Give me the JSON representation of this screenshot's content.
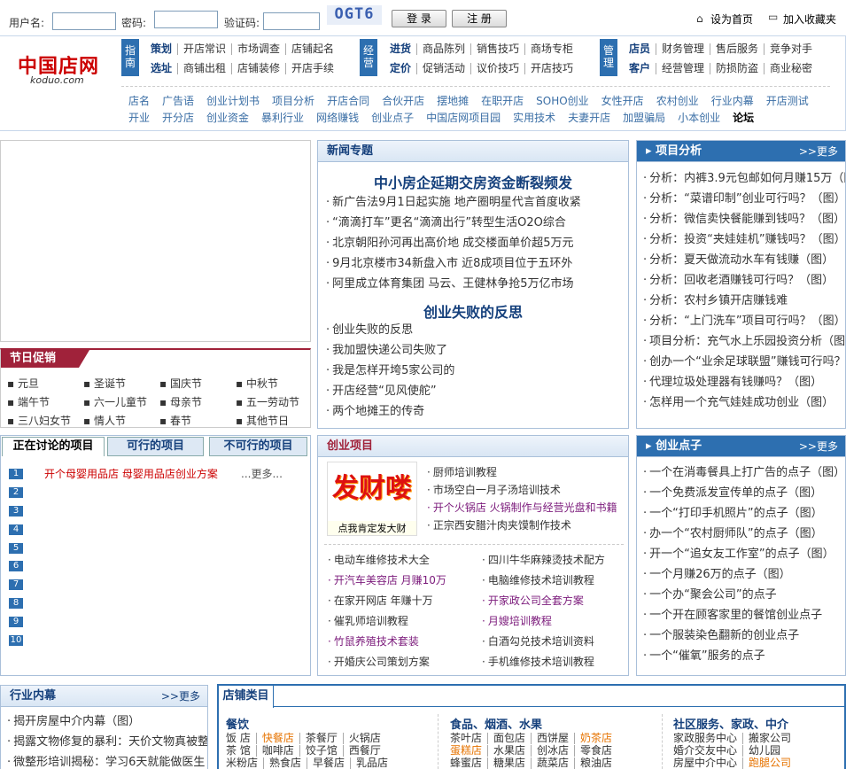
{
  "login": {
    "user_label": "用户名:",
    "pass_label": "密码:",
    "code_label": "验证码:",
    "captcha": "OGT6",
    "login_btn": "登 录",
    "register_btn": "注 册",
    "home": "设为首页",
    "fav": "加入收藏夹"
  },
  "logo": {
    "title": "中国店网",
    "site": "koduo.com"
  },
  "nav": {
    "g1": {
      "tag": "指南",
      "r1": [
        "策划",
        "开店常识",
        "市场调查",
        "店铺起名"
      ],
      "r2": [
        "选址",
        "商铺出租",
        "店铺装修",
        "开店手续"
      ]
    },
    "g2": {
      "tag": "经营",
      "r1": [
        "进货",
        "商品陈列",
        "销售技巧",
        "商场专柜"
      ],
      "r2": [
        "定价",
        "促销活动",
        "议价技巧",
        "开店技巧"
      ]
    },
    "g3": {
      "tag": "管理",
      "r1": [
        "店员",
        "财务管理",
        "售后服务",
        "竞争对手"
      ],
      "r2": [
        "客户",
        "经营管理",
        "防损防盗",
        "商业秘密"
      ]
    }
  },
  "links": {
    "r1": [
      "店名",
      "广告语",
      "创业计划书",
      "项目分析",
      "开店合同",
      "合伙开店",
      "摆地摊",
      "在职开店",
      "SOHO创业",
      "女性开店",
      "农村创业",
      "行业内幕",
      "开店测试"
    ],
    "r2": [
      "开业",
      "开分店",
      "创业资金",
      "暴利行业",
      "网络赚钱",
      "创业点子",
      "中国店网项目园",
      "实用技术",
      "夫妻开店",
      "加盟骗局",
      "小本创业",
      "论坛"
    ]
  },
  "holiday": {
    "title": "节日促销",
    "items": [
      "元旦",
      "圣诞节",
      "国庆节",
      "中秋节",
      "端午节",
      "六一儿童节",
      "母亲节",
      "五一劳动节",
      "三八妇女节",
      "情人节",
      "春节",
      "其他节日"
    ]
  },
  "news": {
    "title": "新闻专题",
    "h1": "中小房企延期交房资金断裂频发",
    "l1": [
      "新广告法9月1日起实施 地产圈明星代言首度收紧",
      "“滴滴打车”更名“滴滴出行”转型生活O2O综合",
      "北京朝阳孙河再出高价地 成交楼面单价超5万元",
      "9月北京楼市34新盘入市 近8成项目位于五环外",
      "阿里成立体育集团 马云、王健林争抢5万亿市场"
    ],
    "h2": "创业失败的反思",
    "l2": [
      "创业失败的反思",
      "我加盟快递公司失败了",
      "我是怎样开垮5家公司的",
      "开店经营“见风使舵”",
      "两个地摊王的传奇"
    ]
  },
  "analysis": {
    "title": "项目分析",
    "more": ">>更多",
    "items": [
      "分析：内裤3.9元包邮如何月赚15万（图",
      "分析：“菜谱印制”创业可行吗？（图）",
      "分析：微信卖快餐能赚到钱吗？（图）",
      "分析：投资“夹娃娃机”赚钱吗？（图）",
      "分析：夏天做流动水车有钱赚（图）",
      "分析：回收老酒赚钱可行吗？（图）",
      "分析：农村乡镇开店赚钱难",
      "分析：“上门洗车”项目可行吗？（图）",
      "项目分析：充气水上乐园投资分析（图）",
      "创办一个“业余足球联盟”赚钱可行吗？",
      "代理垃圾处理器有钱赚吗？（图）",
      "怎样用一个充气娃娃成功创业（图）"
    ]
  },
  "tabs": {
    "t1": "正在讨论的项目",
    "t2": "可行的项目",
    "t3": "不可行的项目",
    "first": "开个母婴用品店 母婴用品店创业方案",
    "more": "...更多...",
    "nums": [
      "1",
      "2",
      "3",
      "4",
      "5",
      "6",
      "7",
      "8",
      "9",
      "10"
    ]
  },
  "startup": {
    "title": "创业项目",
    "img_text": "发财喽",
    "img_caption": "点我肯定发大财",
    "top": [
      "厨师培训教程",
      "市场空白一月子汤培训技术",
      "开个火锅店 火锅制作与经营光盘和书籍",
      "正宗西安腊汁肉夹馍制作技术"
    ],
    "left": [
      "电动车维修技术大全",
      "开汽车美容店 月赚10万",
      "在家开网店 年赚十万",
      "催乳师培训教程",
      "竹鼠养殖技术套装",
      "开婚庆公司策划方案"
    ],
    "right": [
      "四川牛华麻辣烫技术配方",
      "电脑维修技术培训教程",
      "开家政公司全套方案",
      "月嫂培训教程",
      "白酒勾兑技术培训资料",
      "手机维修技术培训教程"
    ]
  },
  "ideas": {
    "title": "创业点子",
    "more": ">>更多",
    "items": [
      "一个在消毒餐具上打广告的点子（图）",
      "一个免费派发宣传单的点子（图）",
      "一个“打印手机照片”的点子（图）",
      "办一个“农村厨师队”的点子（图）",
      "开一个“追女友工作室”的点子（图）",
      "一个月赚26万的点子（图）",
      "一个办“聚会公司”的点子",
      "一个开在顾客家里的餐馆创业点子",
      "一个服装染色翻新的创业点子",
      "一个“催氧”服务的点子"
    ]
  },
  "industry": {
    "title": "行业内幕",
    "more": ">>更多",
    "items": [
      "揭开房屋中介内幕（图）",
      "揭露文物修复的暴利：天价文物真被整",
      "微整形培训揭秘：学习6天就能做医生"
    ]
  },
  "category": {
    "title": "店铺类目",
    "c1": {
      "h": "餐饮",
      "r1": [
        "饭 店",
        "快餐店",
        "茶餐厅",
        "火锅店"
      ],
      "r2": [
        "茶 馆",
        "咖啡店",
        "饺子馆",
        "西餐厅"
      ],
      "r3": [
        "米粉店",
        "熟食店",
        "早餐店",
        "乳品店"
      ]
    },
    "c2": {
      "h": "食品、烟酒、水果",
      "r1": [
        "茶叶店",
        "面包店",
        "西饼屋",
        "奶茶店"
      ],
      "r2": [
        "蛋糕店",
        "水果店",
        "创冰店",
        "零食店"
      ],
      "r3": [
        "蜂蜜店",
        "糖果店",
        "蔬菜店",
        "粮油店"
      ]
    },
    "c3": {
      "h": "社区服务、家政、中介",
      "r1": [
        "家政服务中心",
        "搬家公司"
      ],
      "r2": [
        "婚介交友中心",
        "幼儿园"
      ],
      "r3": [
        "房屋中介中心",
        "跑腿公司"
      ]
    }
  }
}
